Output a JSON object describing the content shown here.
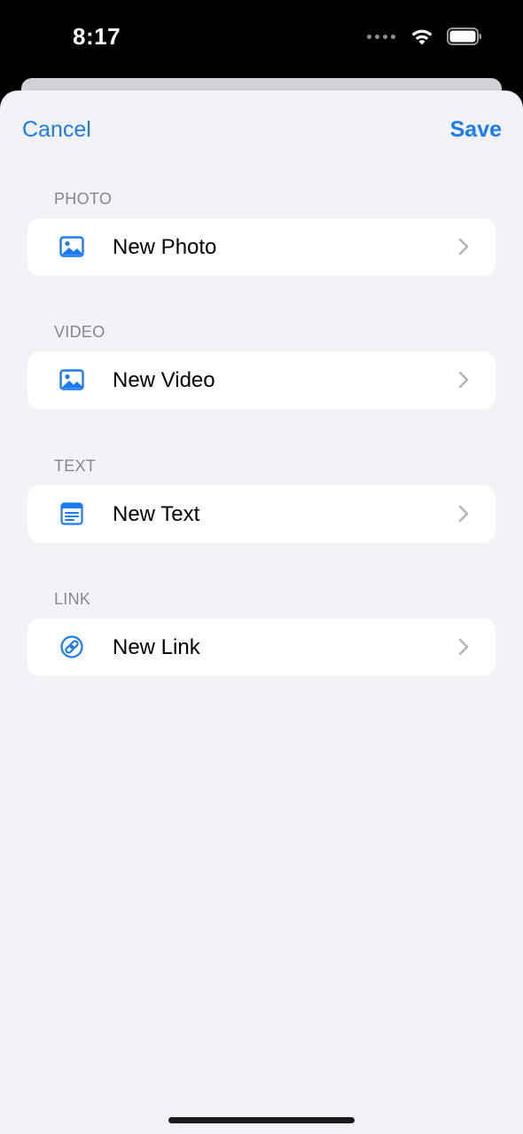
{
  "status_bar": {
    "time": "8:17"
  },
  "nav": {
    "cancel_label": "Cancel",
    "save_label": "Save"
  },
  "sections": [
    {
      "header": "PHOTO",
      "item_label": "New Photo",
      "icon": "photo-icon"
    },
    {
      "header": "VIDEO",
      "item_label": "New Video",
      "icon": "photo-icon"
    },
    {
      "header": "TEXT",
      "item_label": "New Text",
      "icon": "text-document-icon"
    },
    {
      "header": "LINK",
      "item_label": "New Link",
      "icon": "link-icon"
    }
  ],
  "colors": {
    "accent": "#1a7cf5",
    "background": "#f2f2f7",
    "row_background": "#ffffff",
    "section_header": "#86868b"
  }
}
